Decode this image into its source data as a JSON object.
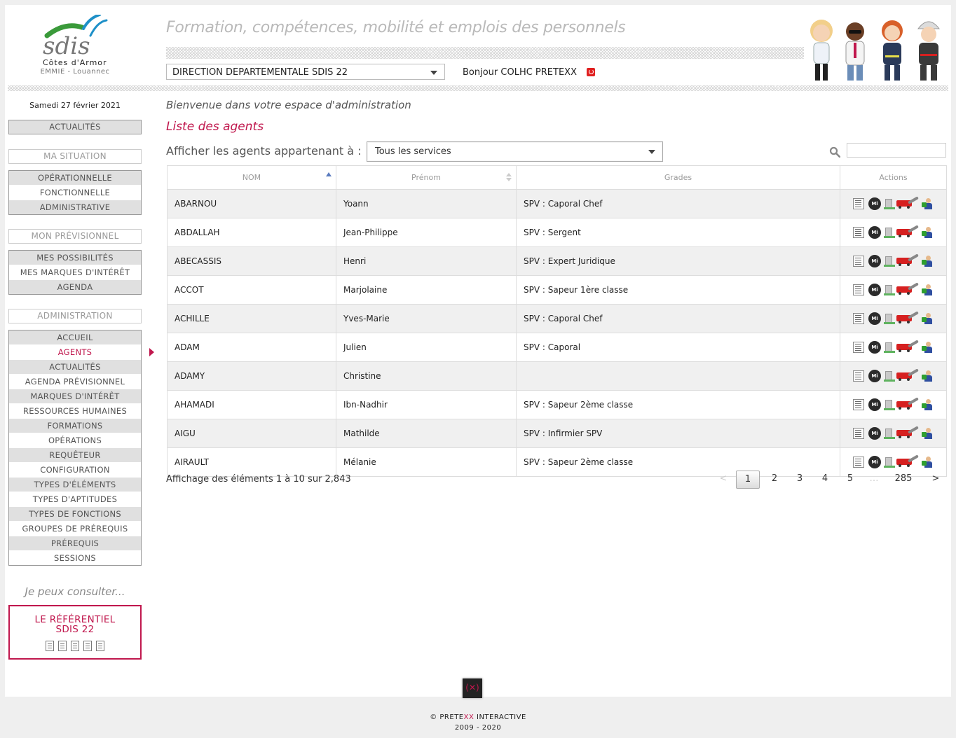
{
  "header": {
    "logo_text": "sdis",
    "logo_region": "Côtes d'Armor",
    "logo_sub": "EMMIE - Louannec",
    "tagline": "Formation, compétences, mobilité et emplois des personnels",
    "direction_select": "DIRECTION DEPARTEMENTALE SDIS 22",
    "greeting": "Bonjour COLHC PRETEXX"
  },
  "sidebar": {
    "date": "Samedi 27 février 2021",
    "actualites": "ACTUALITÉS",
    "ma_situation": {
      "heading": "MA SITUATION",
      "items": [
        "OPÉRATIONNELLE",
        "FONCTIONNELLE",
        "ADMINISTRATIVE"
      ]
    },
    "mon_previsionnel": {
      "heading": "MON PRÉVISIONNEL",
      "items": [
        "MES POSSIBILITÉS",
        "MES MARQUES D'INTÉRÊT",
        "AGENDA"
      ]
    },
    "administration": {
      "heading": "ADMINISTRATION",
      "items": [
        "ACCUEIL",
        "AGENTS",
        "ACTUALITÉS",
        "AGENDA PRÉVISIONNEL",
        "MARQUES D'INTÉRÊT",
        "RESSOURCES HUMAINES",
        "FORMATIONS",
        "OPÉRATIONS",
        "REQUÊTEUR",
        "CONFIGURATION",
        "TYPES D'ÉLÉMENTS",
        "TYPES D'APTITUDES",
        "TYPES DE FONCTIONS",
        "GROUPES DE PRÉREQUIS",
        "PRÉREQUIS",
        "SESSIONS"
      ],
      "active": "AGENTS"
    },
    "consult": "Je peux consulter...",
    "referentiel": "LE RÉFÉRENTIEL\nSDIS 22"
  },
  "main": {
    "welcome": "Bienvenue dans votre espace d'administration",
    "title": "Liste des agents",
    "filter_label": "Afficher les agents appartenant à :",
    "service_select": "Tous les services",
    "columns": [
      "NOM",
      "Prénom",
      "Grades",
      "Actions"
    ],
    "rows": [
      {
        "nom": "ABARNOU",
        "prenom": "Yoann",
        "grade": "SPV : Caporal Chef"
      },
      {
        "nom": "ABDALLAH",
        "prenom": "Jean-Philippe",
        "grade": "SPV : Sergent"
      },
      {
        "nom": "ABECASSIS",
        "prenom": "Henri",
        "grade": "SPV : Expert Juridique"
      },
      {
        "nom": "ACCOT",
        "prenom": "Marjolaine",
        "grade": "SPV : Sapeur 1ère classe"
      },
      {
        "nom": "ACHILLE",
        "prenom": "Yves-Marie",
        "grade": "SPV : Caporal Chef"
      },
      {
        "nom": "ADAM",
        "prenom": "Julien",
        "grade": "SPV : Caporal"
      },
      {
        "nom": "ADAMY",
        "prenom": "Christine",
        "grade": ""
      },
      {
        "nom": "AHAMADI",
        "prenom": "Ibn-Nadhir",
        "grade": "SPV : Sapeur 2ème classe"
      },
      {
        "nom": "AIGU",
        "prenom": "Mathilde",
        "grade": "SPV : Infirmier SPV"
      },
      {
        "nom": "AIRAULT",
        "prenom": "Mélanie",
        "grade": "SPV : Sapeur 2ème classe"
      }
    ],
    "mi_label": "Mi",
    "records_info": "Affichage des éléments 1 à 10 sur 2,843",
    "pagination": [
      "<",
      "1",
      "2",
      "3",
      "4",
      "5",
      "…",
      "285",
      ">"
    ]
  },
  "footer": {
    "copyright_pre": "© PRETE",
    "copyright_xx": "XX",
    "copyright_post": " INTERACTIVE",
    "years": "2009 - 2020"
  },
  "colors": {
    "accent": "#c0174d",
    "logo_green": "#3a9a3a",
    "logo_blue": "#1e90c8"
  }
}
